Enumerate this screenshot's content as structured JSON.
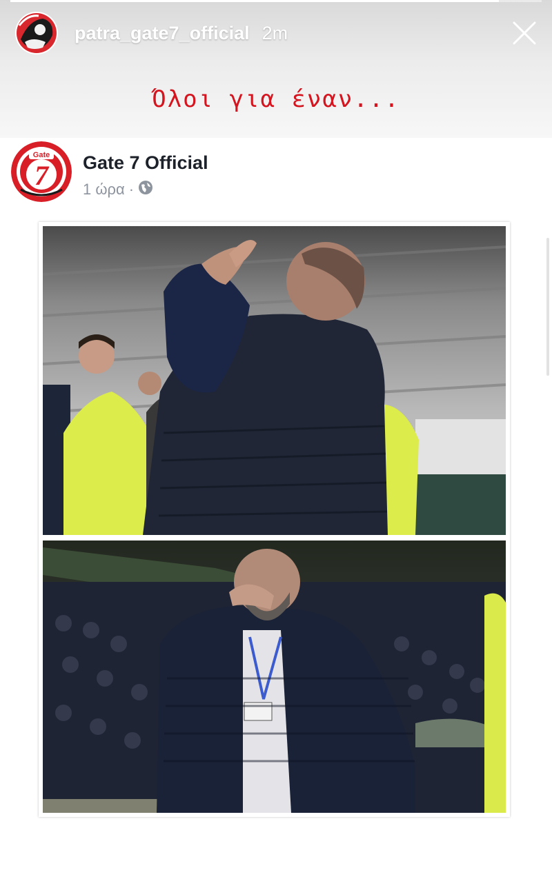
{
  "story": {
    "username": "patra_gate7_official",
    "time_ago": "2m",
    "progress": 0.92,
    "caption": "Όλοι για έναν..."
  },
  "post": {
    "page_name": "Gate 7 Official",
    "time": "1 ώρα",
    "separator": "·",
    "privacy_icon": "globe-icon",
    "logo_text": "Gate",
    "logo_number": "7"
  },
  "colors": {
    "caption_red": "#d4141e",
    "logo_red": "#d81e27",
    "name_text": "#1d2129",
    "meta_text": "#8d949e"
  },
  "icons": {
    "close": "close-icon",
    "globe": "globe-icon"
  }
}
